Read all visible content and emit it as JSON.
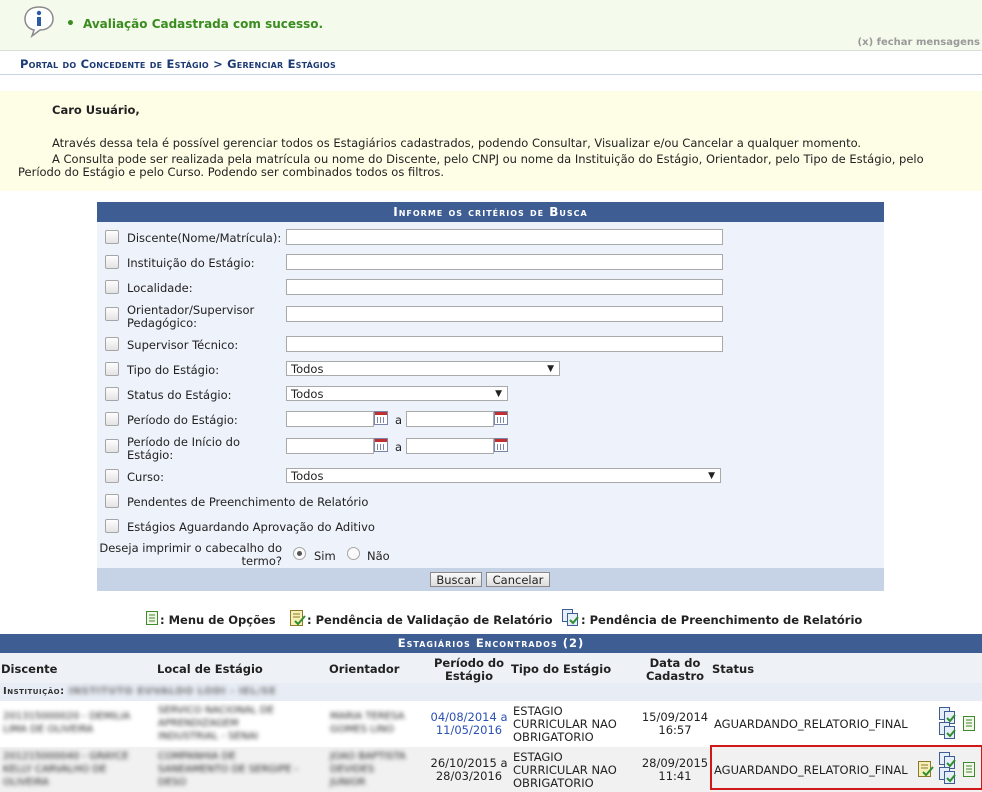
{
  "message": {
    "text": "Avaliação Cadastrada com sucesso.",
    "close": "(x) fechar mensagens"
  },
  "breadcrumb": "Portal do Concedente de Estágio > Gerenciar Estágios",
  "info": {
    "greeting": "Caro Usuário,",
    "p1": "Através dessa tela é possível gerenciar todos os Estagiários cadastrados, podendo Consultar, Visualizar e/ou Cancelar a qualquer momento.",
    "p2": "A Consulta pode ser realizada pela matrícula ou nome do Discente, pelo CNPJ ou nome da Instituição do Estágio, Orientador, pelo Tipo de Estágio, pelo",
    "p3": "Período do Estágio e pelo Curso. Podendo ser combinados todos os filtros."
  },
  "form": {
    "title": "Informe os critérios de Busca",
    "discente": "Discente(Nome/Matrícula):",
    "instituicao": "Instituição do Estágio:",
    "localidade": "Localidade:",
    "orientador_l1": "Orientador/Supervisor",
    "orientador_l2": "Pedagógico:",
    "supervisor": "Supervisor Técnico:",
    "tipo": "Tipo do Estágio:",
    "tipo_value": "Todos",
    "status": "Status do Estágio:",
    "status_value": "Todos",
    "periodo": "Período do Estágio:",
    "periodo_sep": "a",
    "inicio_l1": "Período de Início do",
    "inicio_l2": "Estágio:",
    "inicio_sep": "a",
    "curso": "Curso:",
    "curso_value": "Todos",
    "pendentes": "Pendentes de Preenchimento de Relatório",
    "aditivo": "Estágios Aguardando Aprovação do Aditivo",
    "imprimir_l1": "Deseja imprimir o cabecalho do",
    "imprimir_l2": "termo?",
    "sim": "Sim",
    "nao": "Não",
    "buscar": "Buscar",
    "cancelar": "Cancelar"
  },
  "legend": {
    "menu": ": Menu de Opções",
    "validacao": ": Pendência de Validação de Relatório",
    "preenchimento": ": Pendência de Preenchimento de Relatório"
  },
  "results": {
    "title": "Estagiários Encontrados (2)",
    "columns": {
      "discente": "Discente",
      "local": "Local de Estágio",
      "orientador": "Orientador",
      "periodo_l1": "Período do",
      "periodo_l2": "Estágio",
      "tipo": "Tipo do Estágio",
      "data_l1": "Data do",
      "data_l2": "Cadastro",
      "status": "Status"
    },
    "institution_label": "Instituição:",
    "institution_name": "INSTITUTO EUVALDO LODI - IEL/SE",
    "rows": [
      {
        "discente_l1": "201315000020 - DEMILIA",
        "discente_l2": "LIMA DE OLIVEIRA",
        "local_l1": "SERVICO NACIONAL DE",
        "local_l2": "APRENDIZAGEM",
        "local_l3": "INDUSTRIAL - SENAI",
        "orientador_l1": "MARIA TERESA",
        "orientador_l2": "GOMES LINO",
        "periodo_l1": "04/08/2014 a",
        "periodo_l2": "11/05/2016",
        "tipo_l1": "ESTAGIO",
        "tipo_l2": "CURRICULAR NAO",
        "tipo_l3": "OBRIGATORIO",
        "data_l1": "15/09/2014",
        "data_l2": "16:57",
        "status": "AGUARDANDO_RELATORIO_FINAL"
      },
      {
        "discente_l1": "201215000040 - GRAYCE",
        "discente_l2": "KELLY CARVALHO DE",
        "discente_l3": "OLIVEIRA",
        "local_l1": "COMPANHIA DE",
        "local_l2": "SANEAMENTO DE SERGIPE -",
        "local_l3": "DESO",
        "orientador_l1": "JOAO BAPTISTA",
        "orientador_l2": "DEVIDES",
        "orientador_l3": "JUNIOR",
        "periodo_l1": "26/10/2015 a",
        "periodo_l2": "28/03/2016",
        "tipo_l1": "ESTAGIO",
        "tipo_l2": "CURRICULAR NAO",
        "tipo_l3": "OBRIGATORIO",
        "data_l1": "28/09/2015",
        "data_l2": "11:41",
        "status": "AGUARDANDO_RELATORIO_FINAL"
      }
    ]
  }
}
